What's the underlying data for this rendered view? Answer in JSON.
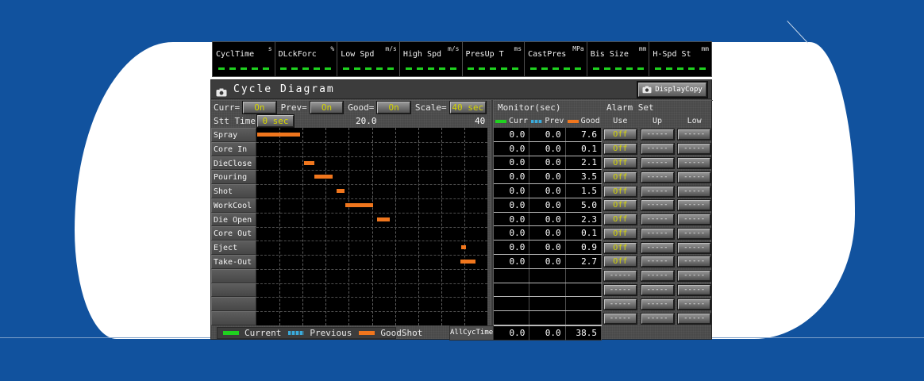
{
  "colors": {
    "background_blue": "#11529e",
    "panel_gray": "#4a4a4a",
    "green": "#1fd11f",
    "cyan": "#3aabdc",
    "orange": "#f0761d",
    "yellow": "#d6d600",
    "value_dash_green": "#1fd11f"
  },
  "status_fields": [
    {
      "label": "CyclTime",
      "unit": "s",
      "value": "-----"
    },
    {
      "label": "DLckForc",
      "unit": "%",
      "value": "-----"
    },
    {
      "label": "Low Spd",
      "unit": "m/s",
      "value": "-----"
    },
    {
      "label": "High Spd",
      "unit": "m/s",
      "value": "-----"
    },
    {
      "label": "PresUp T",
      "unit": "ms",
      "value": "-----"
    },
    {
      "label": "CastPres",
      "unit": "MPa",
      "value": "-----"
    },
    {
      "label": "Bis Size",
      "unit": "mm",
      "value": "-----"
    },
    {
      "label": "H-Spd St",
      "unit": "mm",
      "value": "-----"
    }
  ],
  "panel": {
    "title": "Cycle Diagram",
    "display_copy_label": "DisplayCopy",
    "controls": {
      "curr_label": "Curr=",
      "curr_value": "On",
      "prev_label": "Prev=",
      "prev_value": "On",
      "good_label": "Good=",
      "good_value": "On",
      "scale_label": "Scale=",
      "scale_value": "40 sec"
    },
    "axis": {
      "stt_label": "Stt Time",
      "stt_value": "0 sec",
      "mid_tick": "20.0",
      "end_tick": "40"
    },
    "monitor": {
      "header": "Monitor(sec)",
      "legend": [
        {
          "label": "Curr",
          "color": "#1fd11f"
        },
        {
          "label": "Prev",
          "color": "#3aabdc"
        },
        {
          "label": "Good",
          "color": "#f0761d"
        }
      ]
    },
    "alarm": {
      "header": "Alarm Set",
      "columns": [
        "Use",
        "Up",
        "Low"
      ]
    },
    "legend": [
      {
        "label": "Current",
        "color": "#1fd11f"
      },
      {
        "label": "Previous",
        "color": "#3aabdc"
      },
      {
        "label": "GoodShot",
        "color": "#f0761d"
      }
    ],
    "all_cyc_time": {
      "label": "AllCycTime",
      "curr": "0.0",
      "prev": "0.0",
      "good": "38.5"
    }
  },
  "chart_data": {
    "type": "bar",
    "subtype": "gantt",
    "title": "Cycle Diagram",
    "x_axis": {
      "min": 0,
      "max": 40,
      "unit": "sec",
      "tick_labels": [
        "0 sec",
        "20.0",
        "40"
      ],
      "grid_step": 4,
      "grid": true
    },
    "bar_color": "#f0761d",
    "rows": [
      {
        "label": "Spray",
        "curr": "0.0",
        "prev": "0.0",
        "good": "7.6",
        "bar": [
          0.1,
          7.5
        ],
        "alarm": [
          "Off",
          "-----",
          "-----"
        ]
      },
      {
        "label": "Core In",
        "curr": "0.0",
        "prev": "0.0",
        "good": "0.1",
        "bar": null,
        "alarm": [
          "Off",
          "-----",
          "-----"
        ]
      },
      {
        "label": "DieClose",
        "curr": "0.0",
        "prev": "0.0",
        "good": "2.1",
        "bar": [
          8.2,
          10.0
        ],
        "alarm": [
          "Off",
          "-----",
          "-----"
        ]
      },
      {
        "label": "Pouring",
        "curr": "0.0",
        "prev": "0.0",
        "good": "3.5",
        "bar": [
          10.0,
          13.2
        ],
        "alarm": [
          "Off",
          "-----",
          "-----"
        ]
      },
      {
        "label": "Shot",
        "curr": "0.0",
        "prev": "0.0",
        "good": "1.5",
        "bar": [
          13.9,
          15.3
        ],
        "alarm": [
          "Off",
          "-----",
          "-----"
        ]
      },
      {
        "label": "WorkCool",
        "curr": "0.0",
        "prev": "0.0",
        "good": "5.0",
        "bar": [
          15.4,
          20.2
        ],
        "alarm": [
          "Off",
          "-----",
          "-----"
        ]
      },
      {
        "label": "Die Open",
        "curr": "0.0",
        "prev": "0.0",
        "good": "2.3",
        "bar": [
          20.9,
          23.1
        ],
        "alarm": [
          "Off",
          "-----",
          "-----"
        ]
      },
      {
        "label": "Core Out",
        "curr": "0.0",
        "prev": "0.0",
        "good": "0.1",
        "bar": null,
        "alarm": [
          "Off",
          "-----",
          "-----"
        ]
      },
      {
        "label": "Eject",
        "curr": "0.0",
        "prev": "0.0",
        "good": "0.9",
        "bar": [
          35.5,
          36.3
        ],
        "alarm": [
          "Off",
          "-----",
          "-----"
        ]
      },
      {
        "label": "Take-Out",
        "curr": "0.0",
        "prev": "0.0",
        "good": "2.7",
        "bar": [
          35.3,
          37.9
        ],
        "alarm": [
          "Off",
          "-----",
          "-----"
        ]
      },
      {
        "label": "",
        "curr": "",
        "prev": "",
        "good": "",
        "bar": null,
        "alarm": [
          "-----",
          "-----",
          "-----"
        ]
      },
      {
        "label": "",
        "curr": "",
        "prev": "",
        "good": "",
        "bar": null,
        "alarm": [
          "-----",
          "-----",
          "-----"
        ]
      },
      {
        "label": "",
        "curr": "",
        "prev": "",
        "good": "",
        "bar": null,
        "alarm": [
          "-----",
          "-----",
          "-----"
        ]
      },
      {
        "label": "",
        "curr": "",
        "prev": "",
        "good": "",
        "bar": null,
        "alarm": [
          "-----",
          "-----",
          "-----"
        ]
      }
    ]
  }
}
